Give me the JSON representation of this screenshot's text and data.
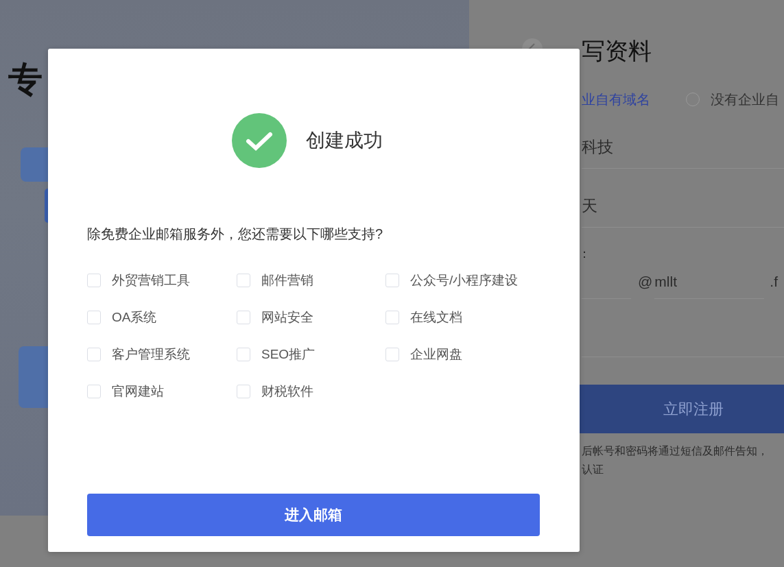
{
  "hero": {
    "title_fragment": "专"
  },
  "form": {
    "title": "写资料",
    "domain_options": [
      {
        "label": "业自有域名",
        "selected": true
      },
      {
        "label": "没有企业自",
        "selected": false
      }
    ],
    "company_value": "科技",
    "name_value": "天",
    "field_label": "：",
    "at_sign": "@",
    "domain_value": "mllt",
    "suffix": ".f",
    "register_button": "立即注册",
    "notes": [
      "后帐号和密码将通过短信及邮件告知，",
      "认证"
    ]
  },
  "dialog": {
    "title": "创建成功",
    "question": "除免费企业邮箱服务外，您还需要以下哪些支持?",
    "options": [
      {
        "label": "外贸营销工具",
        "checked": false
      },
      {
        "label": "邮件营销",
        "checked": false
      },
      {
        "label": "公众号/小程序建设",
        "checked": false
      },
      {
        "label": "OA系统",
        "checked": false
      },
      {
        "label": "网站安全",
        "checked": false
      },
      {
        "label": "在线文档",
        "checked": false
      },
      {
        "label": "客户管理系统",
        "checked": false
      },
      {
        "label": "SEO推广",
        "checked": false
      },
      {
        "label": "企业网盘",
        "checked": false
      },
      {
        "label": "官网建站",
        "checked": false
      },
      {
        "label": "财税软件",
        "checked": false
      }
    ],
    "button": "进入邮箱"
  }
}
